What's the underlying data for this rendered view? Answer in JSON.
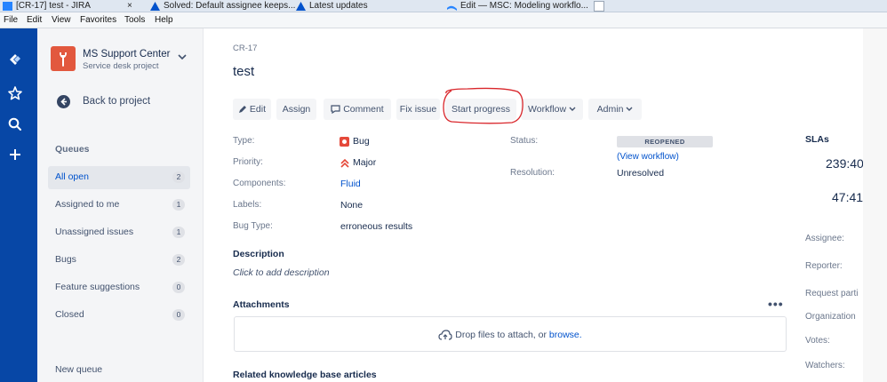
{
  "browser": {
    "tabs": [
      {
        "label": "[CR-17] test - JIRA",
        "close": "×"
      },
      {
        "label": "Solved: Default assignee keeps..."
      },
      {
        "label": "Latest updates"
      },
      {
        "label": "Edit — MSC: Modeling workflo..."
      }
    ],
    "menu": [
      "File",
      "Edit",
      "View",
      "Favorites",
      "Tools",
      "Help"
    ]
  },
  "global_nav": {
    "icons": [
      "jira-logo-icon",
      "star-icon",
      "search-icon",
      "plus-icon"
    ]
  },
  "sidebar": {
    "project_name": "MS Support Center",
    "project_type": "Service desk project",
    "back_label": "Back to project",
    "queues_heading": "Queues",
    "queues": [
      {
        "label": "All open",
        "count": "2",
        "active": true
      },
      {
        "label": "Assigned to me",
        "count": "1"
      },
      {
        "label": "Unassigned issues",
        "count": "1"
      },
      {
        "label": "Bugs",
        "count": "2"
      },
      {
        "label": "Feature suggestions",
        "count": "0"
      },
      {
        "label": "Closed",
        "count": "0"
      }
    ],
    "new_queue": "New queue"
  },
  "issue": {
    "key": "CR-17",
    "title": "test",
    "toolbar": {
      "edit": "Edit",
      "assign": "Assign",
      "comment": "Comment",
      "fix_issue": "Fix issue",
      "start_progress": "Start progress",
      "workflow": "Workflow",
      "admin": "Admin"
    },
    "fields": {
      "type_label": "Type:",
      "type_value": "Bug",
      "priority_label": "Priority:",
      "priority_value": "Major",
      "components_label": "Components:",
      "components_value": "Fluid",
      "labels_label": "Labels:",
      "labels_value": "None",
      "bug_type_label": "Bug Type:",
      "bug_type_value": "erroneous results",
      "status_label": "Status:",
      "status_value": "REOPENED",
      "view_workflow": "(View workflow)",
      "resolution_label": "Resolution:",
      "resolution_value": "Unresolved"
    },
    "description_heading": "Description",
    "description_placeholder": "Click to add description",
    "attachments_heading": "Attachments",
    "attachments_more": "•••",
    "drop_text": "Drop files to attach, or ",
    "drop_link": "browse.",
    "related_heading": "Related knowledge base articles"
  },
  "right_panel": {
    "slas_heading": "SLAs",
    "sla_values": [
      "239:40",
      "47:41"
    ],
    "people": [
      "Assignee:",
      "Reporter:",
      "Request parti",
      "Organization",
      "Votes:",
      "Watchers:"
    ]
  },
  "colors": {
    "nav": "#0747a6",
    "accent": "#0052cc",
    "annotation": "#d9262b",
    "bug": "#e5493a",
    "priority": "#e5493a"
  }
}
